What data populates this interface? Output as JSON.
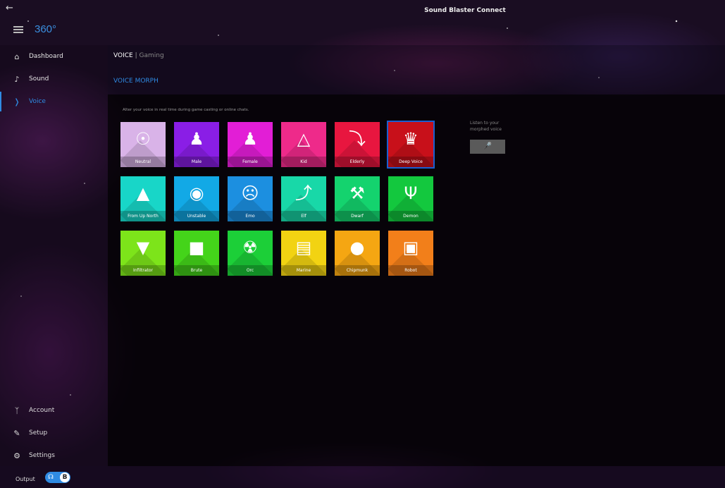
{
  "window": {
    "title": "Sound Blaster Connect",
    "back_icon": "back-arrow-icon"
  },
  "header": {
    "logo_text": "360°",
    "menu_icon": "hamburger-icon"
  },
  "sidebar": {
    "items": [
      {
        "label": "Dashboard",
        "icon": "home-icon",
        "active": false
      },
      {
        "label": "Sound",
        "icon": "music-note-icon",
        "active": false
      },
      {
        "label": "Voice",
        "icon": "voice-icon",
        "active": true
      }
    ],
    "bottom_items": [
      {
        "label": "Account",
        "icon": "person-icon"
      },
      {
        "label": "Setup",
        "icon": "wrench-icon"
      },
      {
        "label": "Settings",
        "icon": "gear-icon"
      }
    ]
  },
  "main": {
    "breadcrumb": {
      "section": "VOICE",
      "separator": "|",
      "profile": "Gaming"
    },
    "section_title": "VOICE MORPH",
    "description": "Alter your voice in real time during game casting or online chats.",
    "listen_label": "Listen to your morphed voice",
    "mic_icon": "microphone-icon"
  },
  "tiles": [
    {
      "label": "Neutral",
      "icon": "neutral-icon",
      "color": "#d9b3e8",
      "selected": false
    },
    {
      "label": "Male",
      "icon": "male-icon",
      "color": "#8a1ee6",
      "selected": false
    },
    {
      "label": "Female",
      "icon": "female-icon",
      "color": "#e21ed6",
      "selected": false
    },
    {
      "label": "Kid",
      "icon": "propeller-hat-icon",
      "color": "#ee2a8a",
      "selected": false
    },
    {
      "label": "Elderly",
      "icon": "cane-icon",
      "color": "#e8163f",
      "selected": false
    },
    {
      "label": "Deep Voice",
      "icon": "bowler-mustache-icon",
      "color": "#c8101a",
      "selected": true
    },
    {
      "label": "From Up North",
      "icon": "mountains-icon",
      "color": "#18d6c8",
      "selected": false
    },
    {
      "label": "Unstable",
      "icon": "unstable-face-icon",
      "color": "#12a9e6",
      "selected": false
    },
    {
      "label": "Emo",
      "icon": "emo-mask-icon",
      "color": "#1c8fe0",
      "selected": false
    },
    {
      "label": "Elf",
      "icon": "bow-icon",
      "color": "#18d8a8",
      "selected": false
    },
    {
      "label": "Dwarf",
      "icon": "axe-icon",
      "color": "#14d36e",
      "selected": false
    },
    {
      "label": "Demon",
      "icon": "trident-icon",
      "color": "#13c83e",
      "selected": false
    },
    {
      "label": "Infiltrator",
      "icon": "alien-icon",
      "color": "#7de41a",
      "selected": false
    },
    {
      "label": "Brute",
      "icon": "brute-icon",
      "color": "#44d41a",
      "selected": false
    },
    {
      "label": "Orc",
      "icon": "orc-icon",
      "color": "#1ccf38",
      "selected": false
    },
    {
      "label": "Marine",
      "icon": "pistol-icon",
      "color": "#f2d312",
      "selected": false
    },
    {
      "label": "Chipmunk",
      "icon": "acorn-icon",
      "color": "#f5a612",
      "selected": false
    },
    {
      "label": "Robot",
      "icon": "robot-icon",
      "color": "#f27f1a",
      "selected": false
    }
  ],
  "footer": {
    "output_label": "Output",
    "output_icon": "headphones-icon",
    "output_knob": "B"
  }
}
